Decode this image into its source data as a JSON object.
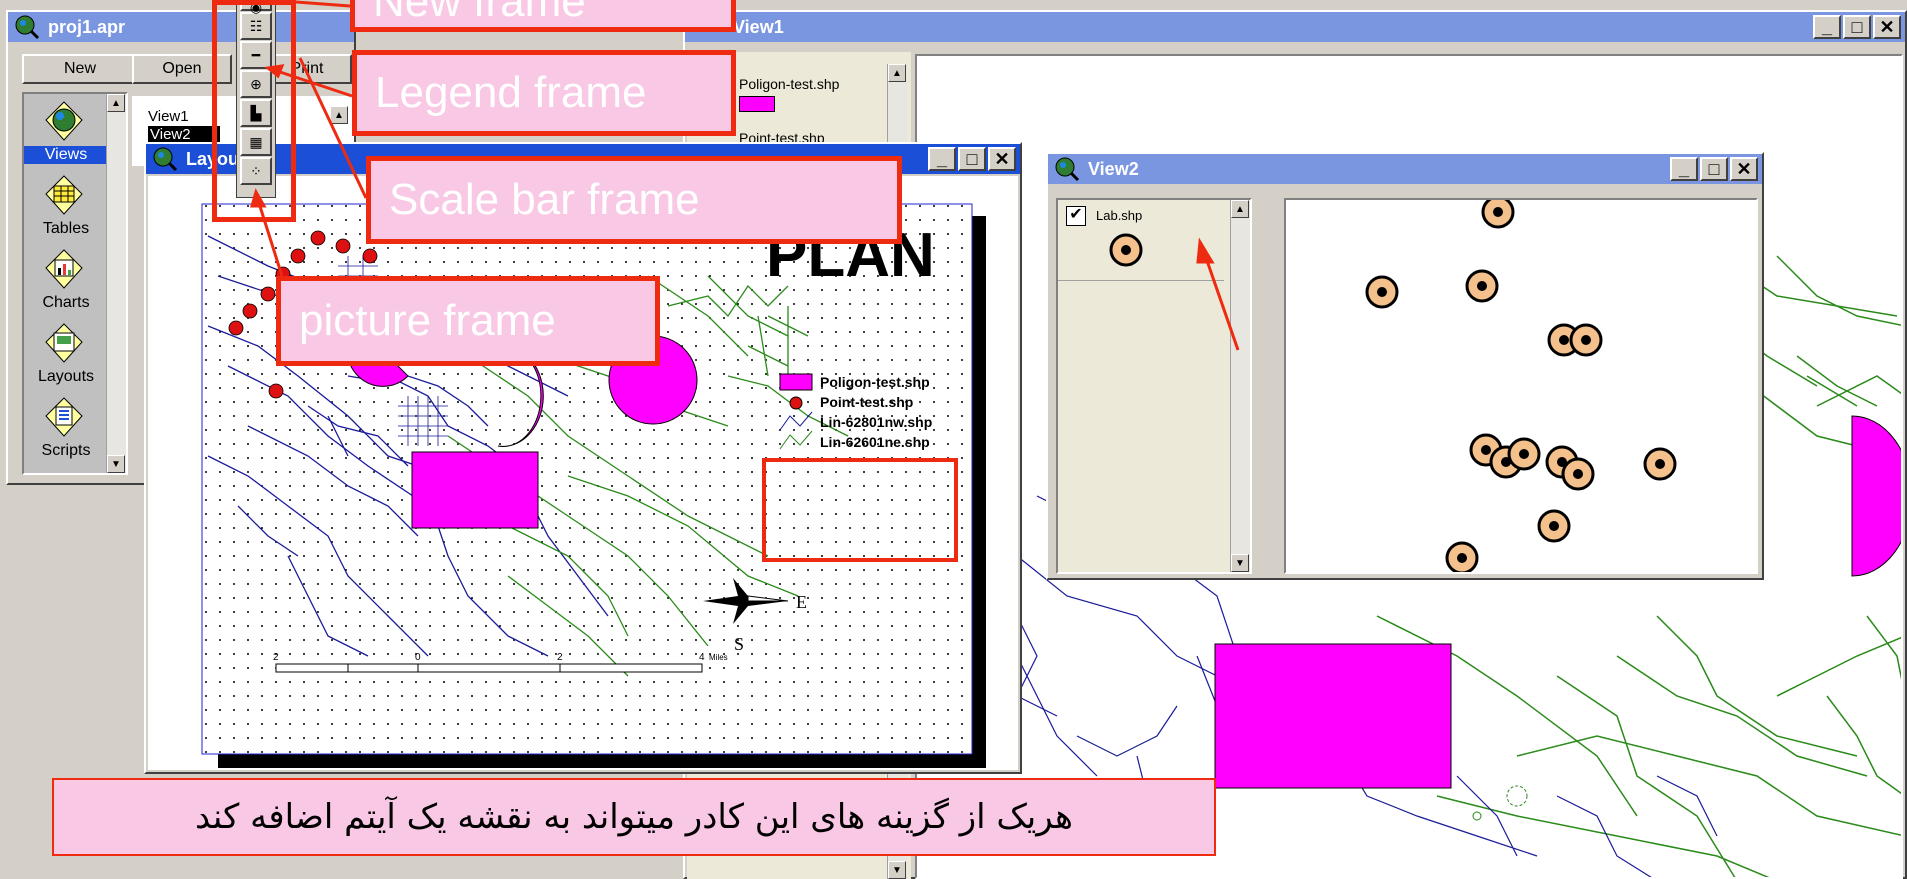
{
  "project_window": {
    "title": "proj1.apr",
    "buttons": {
      "new": "New",
      "open": "Open",
      "print": "Print"
    },
    "categories": [
      "Views",
      "Tables",
      "Charts",
      "Layouts",
      "Scripts"
    ],
    "items": [
      "View1",
      "View2"
    ]
  },
  "view1_window": {
    "title": "View1",
    "toc": [
      "Poligon-test.shp",
      "Point-test.shp"
    ]
  },
  "layout_window": {
    "title": "Layout",
    "map_title": "PLAN",
    "legend": [
      "Poligon-test.shp",
      "Point-test.shp",
      "Lin-62801nw.shp",
      "Lin-62601ne.shp"
    ],
    "scale_labels": [
      "2",
      "0",
      "2",
      "4"
    ],
    "scale_units": "Miles",
    "north_arrow": {
      "east": "E",
      "south": "S"
    }
  },
  "view2_window": {
    "title": "View2",
    "toc": [
      "Lab.shp"
    ],
    "toc_checked": true
  },
  "callouts": {
    "new_frame": "New frame",
    "legend_frame": "Legend frame",
    "scale_bar_frame": "Scale bar frame",
    "picture_frame": "picture frame"
  },
  "caption": "هریک از گزینه های این کادر میتواند به نقشه یک آیتم اضافه کند",
  "colors": {
    "title_active": "#1b4fd8",
    "title_inactive": "#7b96e0",
    "callout_border": "#ee2a10",
    "callout_fill": "#f8c8e4",
    "polygon": "#ff00ff",
    "lines_green": "#2a8a1a",
    "lines_blue": "#1a1a9a"
  },
  "frame_toolbar_icons": [
    "globe-frame-icon",
    "legend-frame-icon",
    "scalebar-frame-icon",
    "north-arrow-frame-icon",
    "chart-frame-icon",
    "table-frame-icon",
    "picture-frame-icon"
  ]
}
